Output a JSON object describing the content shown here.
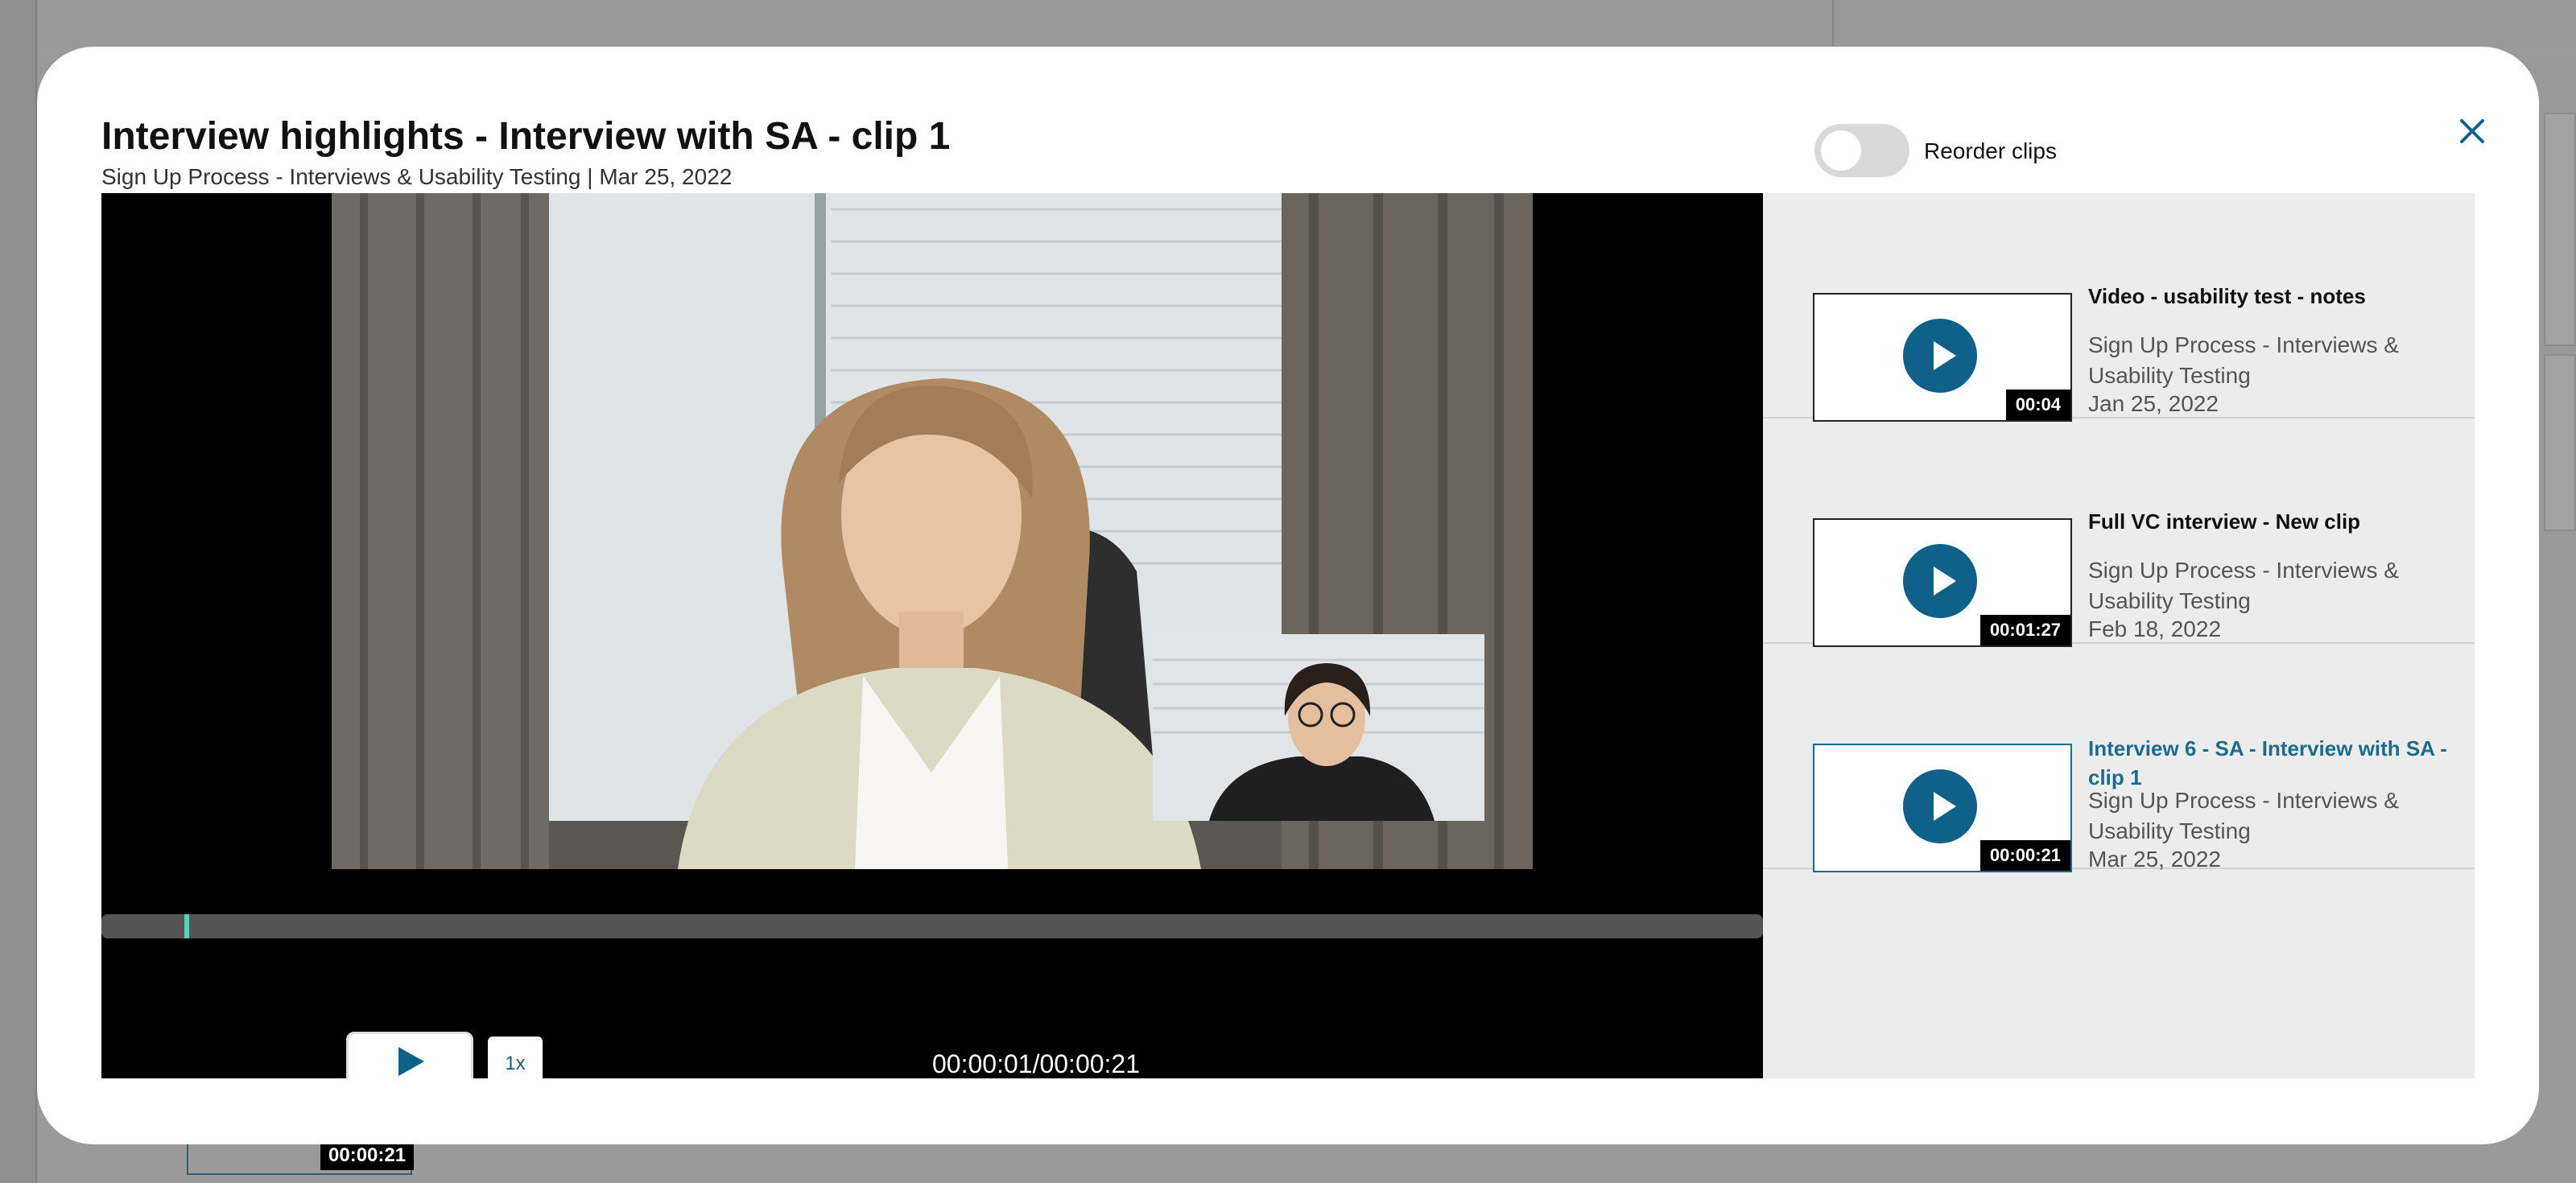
{
  "background": {
    "thumb_duration": "00:00:21"
  },
  "modal": {
    "title": "Interview highlights - Interview with SA - clip 1",
    "subtitle_project": "Sign Up Process - Interviews & Usability Testing",
    "subtitle_separator": "|",
    "subtitle_date": "Mar 25, 2022",
    "reorder_label": "Reorder clips",
    "reorder_enabled": false,
    "close_icon": "close-icon"
  },
  "player": {
    "speed_label": "1x",
    "timecode": "00:00:01/00:00:21",
    "progress_fraction": 0.05,
    "accent_color": "#4fd6b4"
  },
  "clips": [
    {
      "title": "Video - usability test - notes",
      "project": "Sign Up Process - Interviews & Usability Testing",
      "date": "Jan 25, 2022",
      "duration": "00:04",
      "active": false
    },
    {
      "title": "Full VC interview - New clip",
      "project": "Sign Up Process - Interviews & Usability Testing",
      "date": "Feb 18, 2022",
      "duration": "00:01:27",
      "active": false
    },
    {
      "title": "Interview 6 - SA - Interview with SA - clip 1",
      "project": "Sign Up Process - Interviews & Usability Testing",
      "date": "Mar 25, 2022",
      "duration": "00:00:21",
      "active": true
    }
  ],
  "colors": {
    "brand": "#0f6189",
    "active_text": "#1c6c90"
  }
}
